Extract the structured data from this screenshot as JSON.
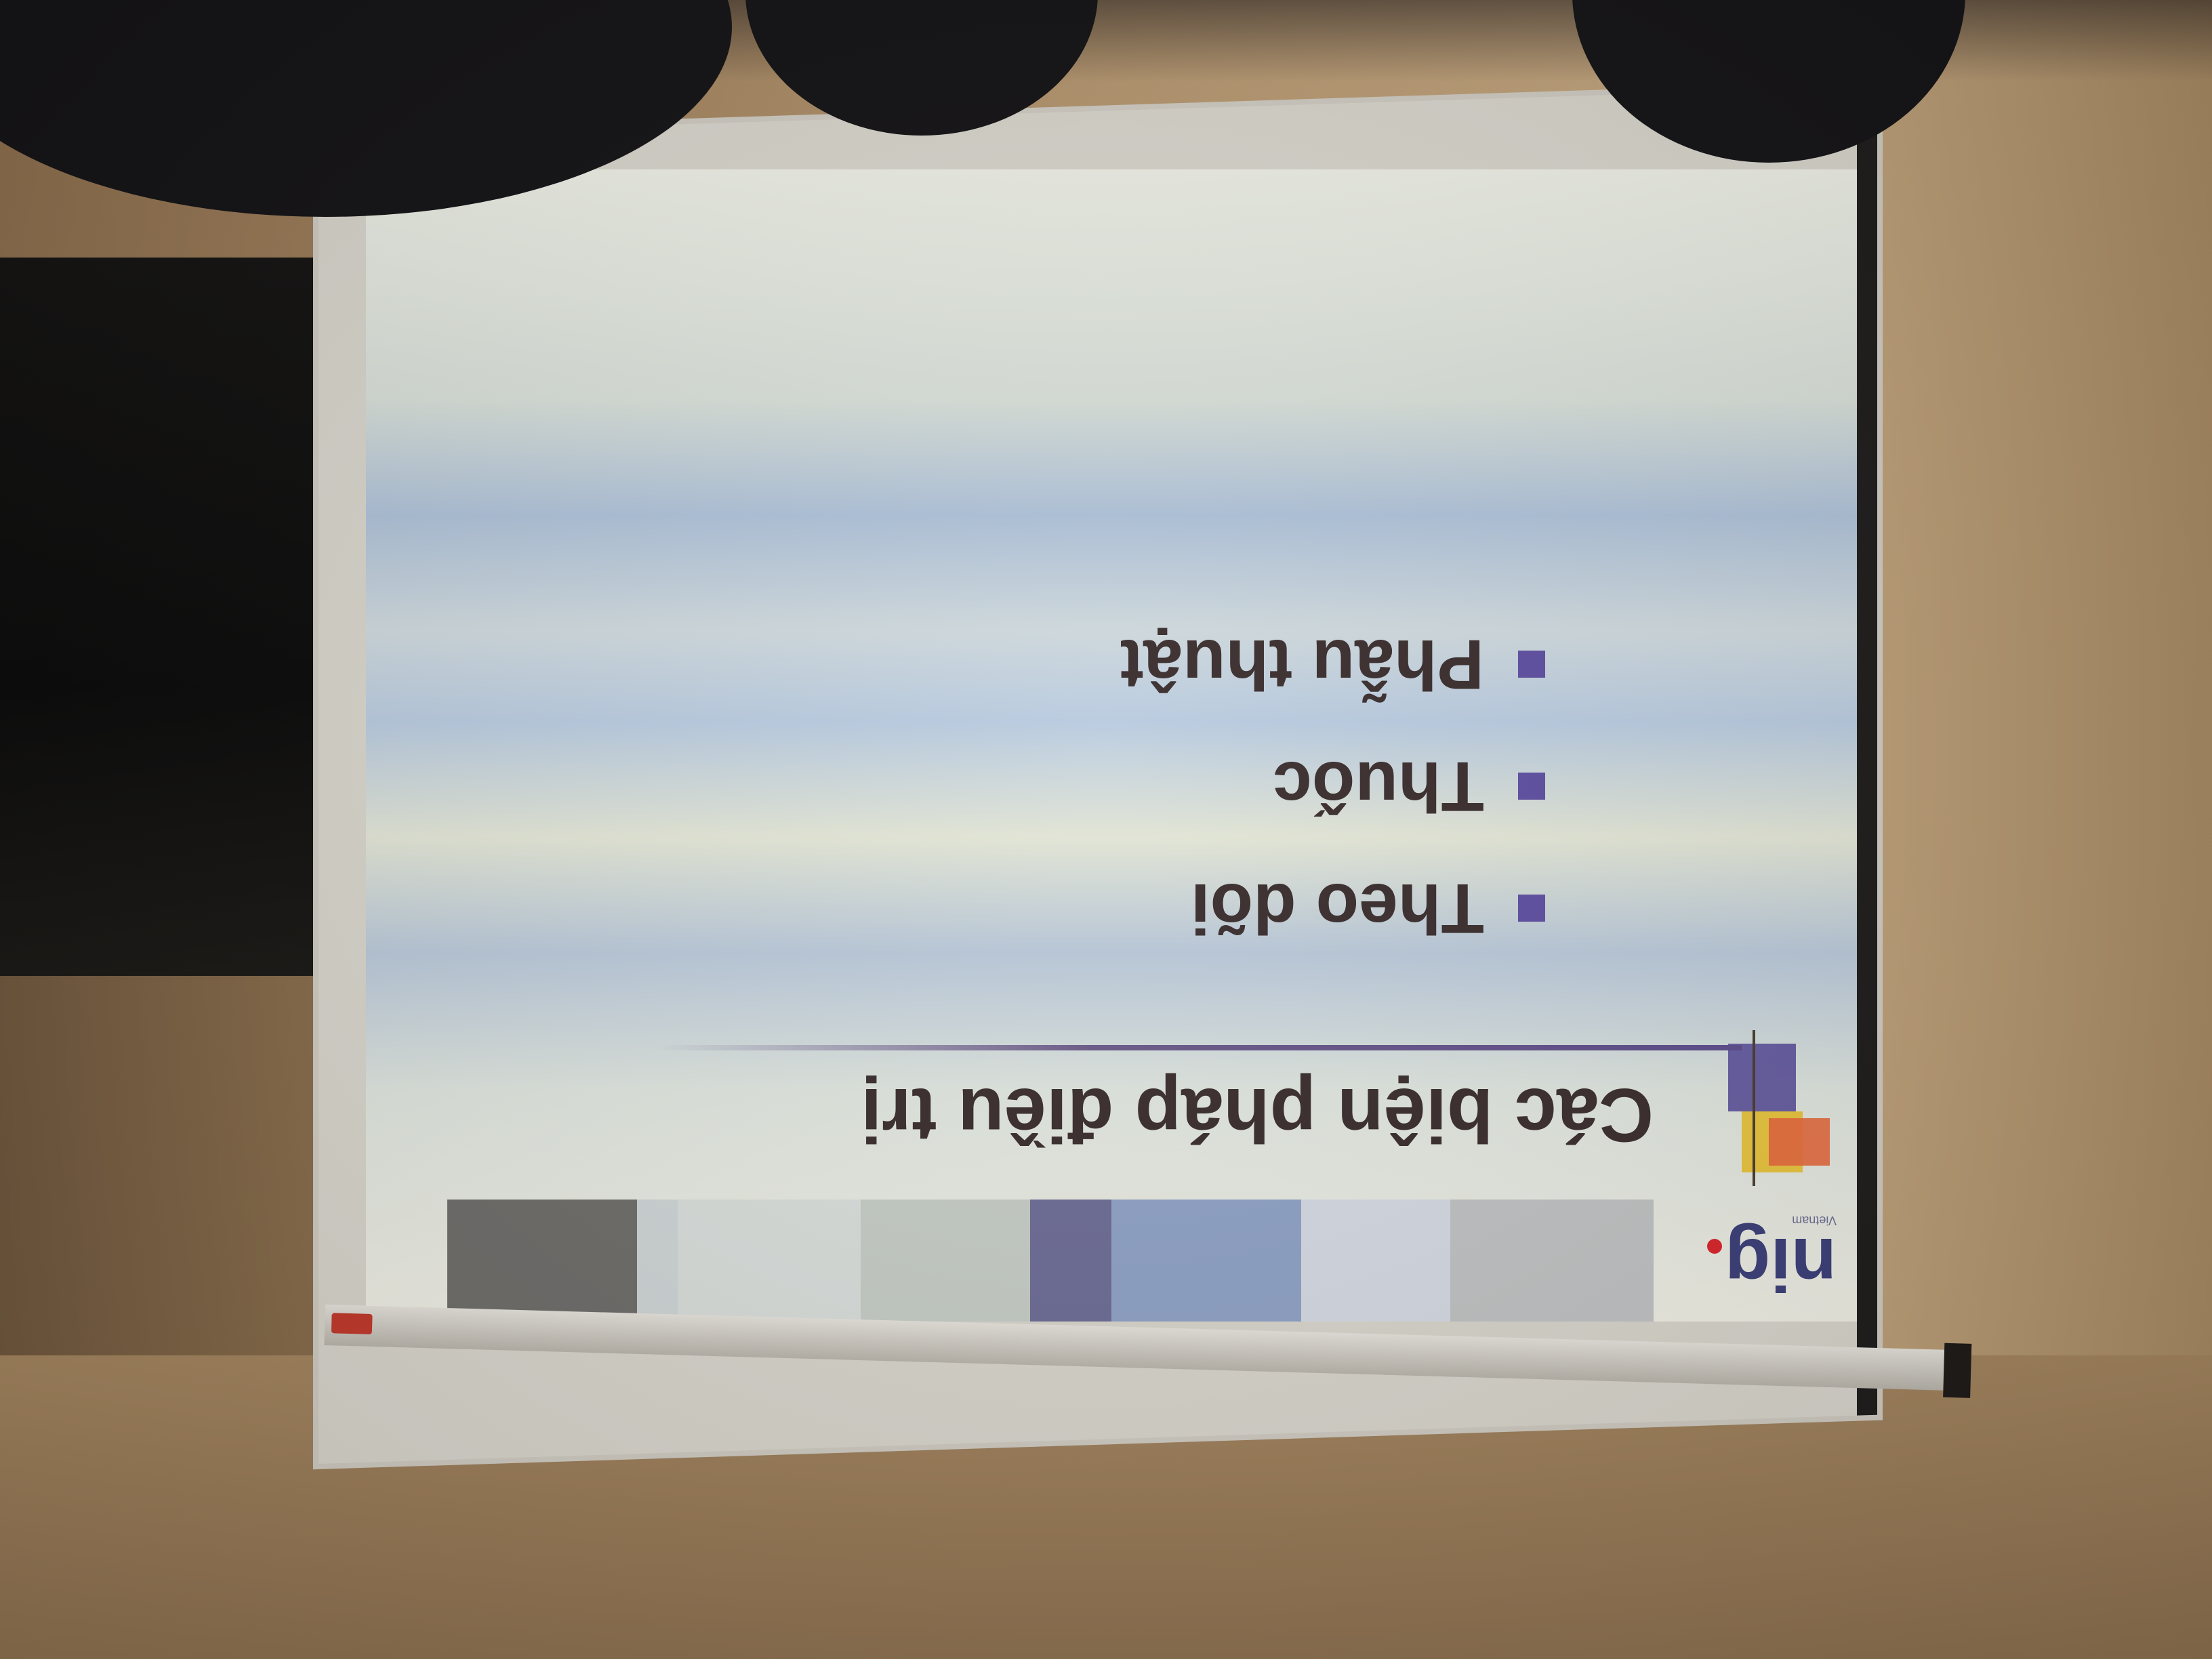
{
  "slide": {
    "logo_text": "nig",
    "logo_subtext": "Vietnam",
    "title": "Các biện pháp điều trị",
    "bullets": [
      "Theo dõi",
      "Thuốc",
      "Phẫu thuật"
    ]
  },
  "colors": {
    "accent": "#5e4fa0",
    "text": "#3a2d2d",
    "logo_blue": "#3b3f78",
    "logo_red": "#d8252b",
    "bar_blocks": [
      "#c0c2c3",
      "#d5dae3",
      "#8fa2c6",
      "#6d6c95",
      "#c6ccc6",
      "#d9dedb",
      "#cfd5d6",
      "#6f6d6a",
      "#8ba0c0"
    ]
  }
}
